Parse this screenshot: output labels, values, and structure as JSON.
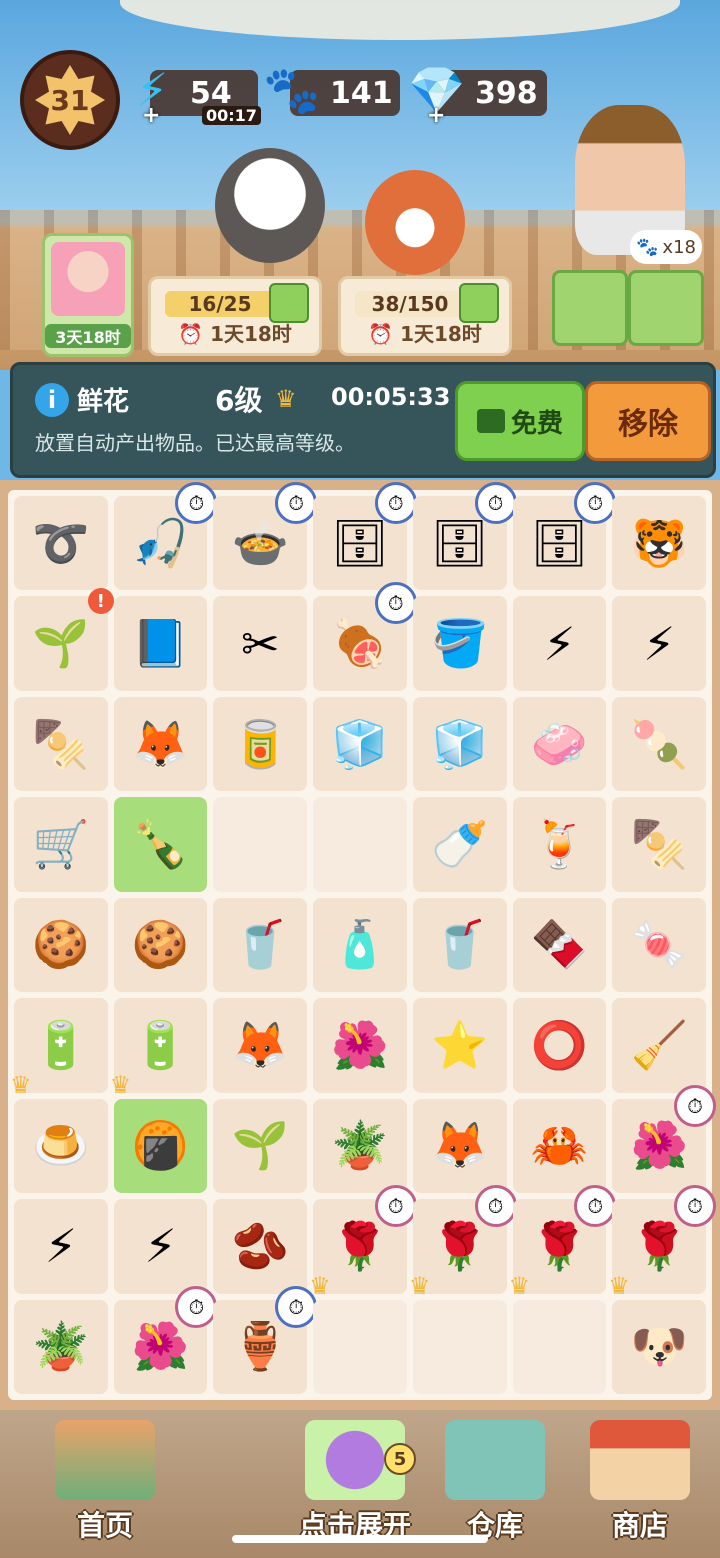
{
  "header": {
    "player_level": "31",
    "energy": {
      "value": "54",
      "timer": "00:17",
      "icon": "lightning-icon"
    },
    "paws": {
      "value": "141",
      "icon": "paw-coin-icon"
    },
    "gems": {
      "value": "398",
      "icon": "diamond-icon"
    }
  },
  "orders": {
    "avatar_timer": "3天18时",
    "order1": {
      "progress_text": "16/25",
      "timer": "1天18时",
      "progress": 0.64
    },
    "order2": {
      "progress_text": "38/150",
      "timer": "1天18时",
      "progress": 0.25
    },
    "paw_count": "x18"
  },
  "info_panel": {
    "item_name": "鲜花",
    "item_level": "6级",
    "timer": "00:05:33",
    "description": "放置自动产出物品。已达最高等级。",
    "free_button": "免费",
    "remove_button": "移除"
  },
  "board": {
    "rows": [
      [
        {
          "icon": "leash-icon",
          "g": "➰"
        },
        {
          "icon": "fishing-rod-icon",
          "g": "🎣",
          "clock": true
        },
        {
          "icon": "pot-icon",
          "g": "🍲",
          "clock": true
        },
        {
          "icon": "vending-machine-icon",
          "g": "🗄",
          "clock": true
        },
        {
          "icon": "vending-machine-icon",
          "g": "🗄",
          "clock": true
        },
        {
          "icon": "vending-machine-icon",
          "g": "🗄",
          "clock": true
        },
        {
          "icon": "tiger-chest-icon",
          "g": "🐯"
        }
      ],
      [
        {
          "icon": "sprout-icon",
          "g": "🌱",
          "alert": true
        },
        {
          "icon": "magic-book-icon",
          "g": "📘"
        },
        {
          "icon": "pruning-shears-icon",
          "g": "✂"
        },
        {
          "icon": "grill-icon",
          "g": "🍖",
          "clock": true
        },
        {
          "icon": "paint-bucket-icon",
          "g": "🪣"
        },
        {
          "icon": "energy-machine-icon",
          "g": "⚡"
        },
        {
          "icon": "energy-frame-icon",
          "g": "⚡"
        }
      ],
      [
        {
          "icon": "takoyaki-tray-icon",
          "g": "🍢"
        },
        {
          "icon": "fox-keychain-icon",
          "g": "🦊"
        },
        {
          "icon": "paint-can-icon",
          "g": "🥫"
        },
        {
          "icon": "ice-cubes-icon",
          "g": "🧊"
        },
        {
          "icon": "ice-cube-icon",
          "g": "🧊"
        },
        {
          "icon": "soap-icon",
          "g": "🧼"
        },
        {
          "icon": "skewer-icon",
          "g": "🍡"
        }
      ],
      [
        {
          "icon": "wheelbarrow-icon",
          "g": "🛒"
        },
        {
          "icon": "bottle-grass-icon",
          "g": "🍾",
          "hl": true
        },
        {
          "empty": true
        },
        {
          "empty": true
        },
        {
          "icon": "milk-bottle-icon",
          "g": "🍼"
        },
        {
          "icon": "jelly-drink-icon",
          "g": "🍹"
        },
        {
          "icon": "meatball-skewer-icon",
          "g": "🍢"
        }
      ],
      [
        {
          "icon": "paw-cookies-icon",
          "g": "🍪"
        },
        {
          "icon": "paw-cookie-icon",
          "g": "🍪"
        },
        {
          "icon": "soda-can-icon",
          "g": "🥤"
        },
        {
          "icon": "drink-bottle-icon",
          "g": "🧴"
        },
        {
          "icon": "juice-cup-icon",
          "g": "🥤"
        },
        {
          "icon": "chocolate-icon",
          "g": "🍫"
        },
        {
          "icon": "candy-icon",
          "g": "🍬"
        }
      ],
      [
        {
          "icon": "battery-icon",
          "g": "🔋",
          "crown": true
        },
        {
          "icon": "battery-icon",
          "g": "🔋",
          "crown": true
        },
        {
          "icon": "fox-pilot-sticker-icon",
          "g": "🦊"
        },
        {
          "icon": "red-petals-icon",
          "g": "🌺"
        },
        {
          "icon": "starfish-icon",
          "g": "⭐"
        },
        {
          "icon": "pet-collar-icon",
          "g": "⭕"
        },
        {
          "icon": "broom-icon",
          "g": "🧹"
        }
      ],
      [
        {
          "icon": "pudding-icon",
          "g": "🍮"
        },
        {
          "icon": "biscuits-icon",
          "g": "🍘",
          "hl": true
        },
        {
          "icon": "seed-sprout-icon",
          "g": "🌱"
        },
        {
          "icon": "potted-sapling-icon",
          "g": "🪴"
        },
        {
          "icon": "fox-sticker-icon",
          "g": "🦊"
        },
        {
          "icon": "crab-icon",
          "g": "🦀"
        },
        {
          "icon": "potted-flower-icon",
          "g": "🌺",
          "clock": true,
          "pink": true
        }
      ],
      [
        {
          "icon": "gold-energy-frame-icon",
          "g": "⚡"
        },
        {
          "icon": "gold-energy-box-icon",
          "g": "⚡"
        },
        {
          "icon": "bean-icon",
          "g": "🫘"
        },
        {
          "icon": "rose-pot-icon",
          "g": "🌹",
          "clock": true,
          "pink": true,
          "crown": true
        },
        {
          "icon": "rose-pot-icon",
          "g": "🌹",
          "clock": true,
          "pink": true,
          "crown": true
        },
        {
          "icon": "rose-pot-icon",
          "g": "🌹",
          "clock": true,
          "pink": true,
          "crown": true
        },
        {
          "icon": "rose-pot-icon",
          "g": "🌹",
          "clock": true,
          "pink": true,
          "crown": true
        }
      ],
      [
        {
          "icon": "potted-plant-icon",
          "g": "🪴"
        },
        {
          "icon": "flower-pot-icon",
          "g": "🌺",
          "clock": true,
          "pink": true
        },
        {
          "icon": "flower-vase-icon",
          "g": "🏺",
          "clock": true
        },
        {
          "empty": true
        },
        {
          "empty": true
        },
        {
          "empty": true
        },
        {
          "icon": "dog-statue-icon",
          "g": "🐶"
        }
      ]
    ]
  },
  "nav": {
    "home": "首页",
    "expand": "点击展开",
    "expand_badge": "5",
    "warehouse": "仓库",
    "shop": "商店"
  },
  "colors": {
    "accent_green": "#7fd04e",
    "accent_orange": "#f29a3c",
    "panel": "#36555a"
  }
}
